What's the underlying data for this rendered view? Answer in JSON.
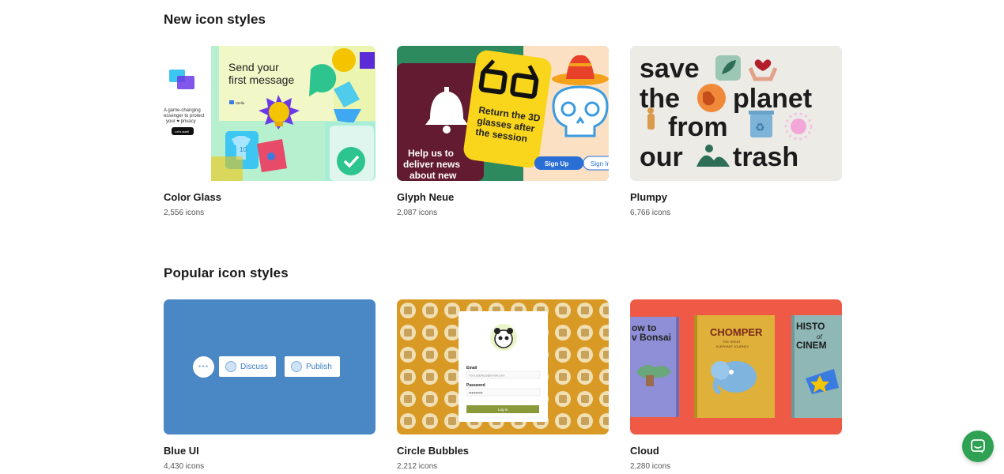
{
  "sections": {
    "new": {
      "title": "New icon styles",
      "cards": [
        {
          "name": "Color Glass",
          "count": "2,556 icons",
          "art": {
            "headline_1": "Send your",
            "headline_2": "first message",
            "body_1": "A game-changing",
            "body_2": "essenger to protect",
            "body_3": "your ♥ privacy",
            "button": "Let's start!",
            "logo": "Stella",
            "shirt_number": "10"
          }
        },
        {
          "name": "Glyph Neue",
          "count": "2,087 icons",
          "art": {
            "card_text_1": "Return the 3D",
            "card_text_2": "glasses after",
            "card_text_3": "the session",
            "bell_text_1": "Help us to",
            "bell_text_2": "deliver news",
            "bell_text_3": "about new",
            "signup": "Sign Up",
            "signin": "Sign In"
          }
        },
        {
          "name": "Plumpy",
          "count": "6,766 icons",
          "art": {
            "word_1": "save",
            "word_2": "the",
            "word_3": "planet",
            "word_4": "from",
            "word_5": "our",
            "word_6": "trash"
          }
        }
      ]
    },
    "popular": {
      "title": "Popular icon styles",
      "cards": [
        {
          "name": "Blue UI",
          "count": "4,430 icons",
          "art": {
            "dots": "•••",
            "discuss": "Discuss",
            "publish": "Publish"
          }
        },
        {
          "name": "Circle Bubbles",
          "count": "2,212 icons",
          "art": {
            "email_label": "Email",
            "email_value": "Your.address@email.com",
            "password_label": "Password",
            "password_value": "••••••••••",
            "login": "Log In"
          }
        },
        {
          "name": "Cloud",
          "count": "2,280 icons",
          "art": {
            "book1_line1": "ow to",
            "book1_line2": "v Bonsai",
            "book2_title": "CHOMPER",
            "book2_sub_1": "THE GREAT",
            "book2_sub_2": "ELEPHANT JOURNEY",
            "book3_line1": "HISTO",
            "book3_line2": "of",
            "book3_line3": "CINEM"
          }
        }
      ]
    }
  },
  "colors": {
    "chat_button": "#2fa153",
    "blue_ui": "#4a87c5",
    "cloud": "#ef5a46"
  },
  "chat_icon": "chat-bubble-icon"
}
